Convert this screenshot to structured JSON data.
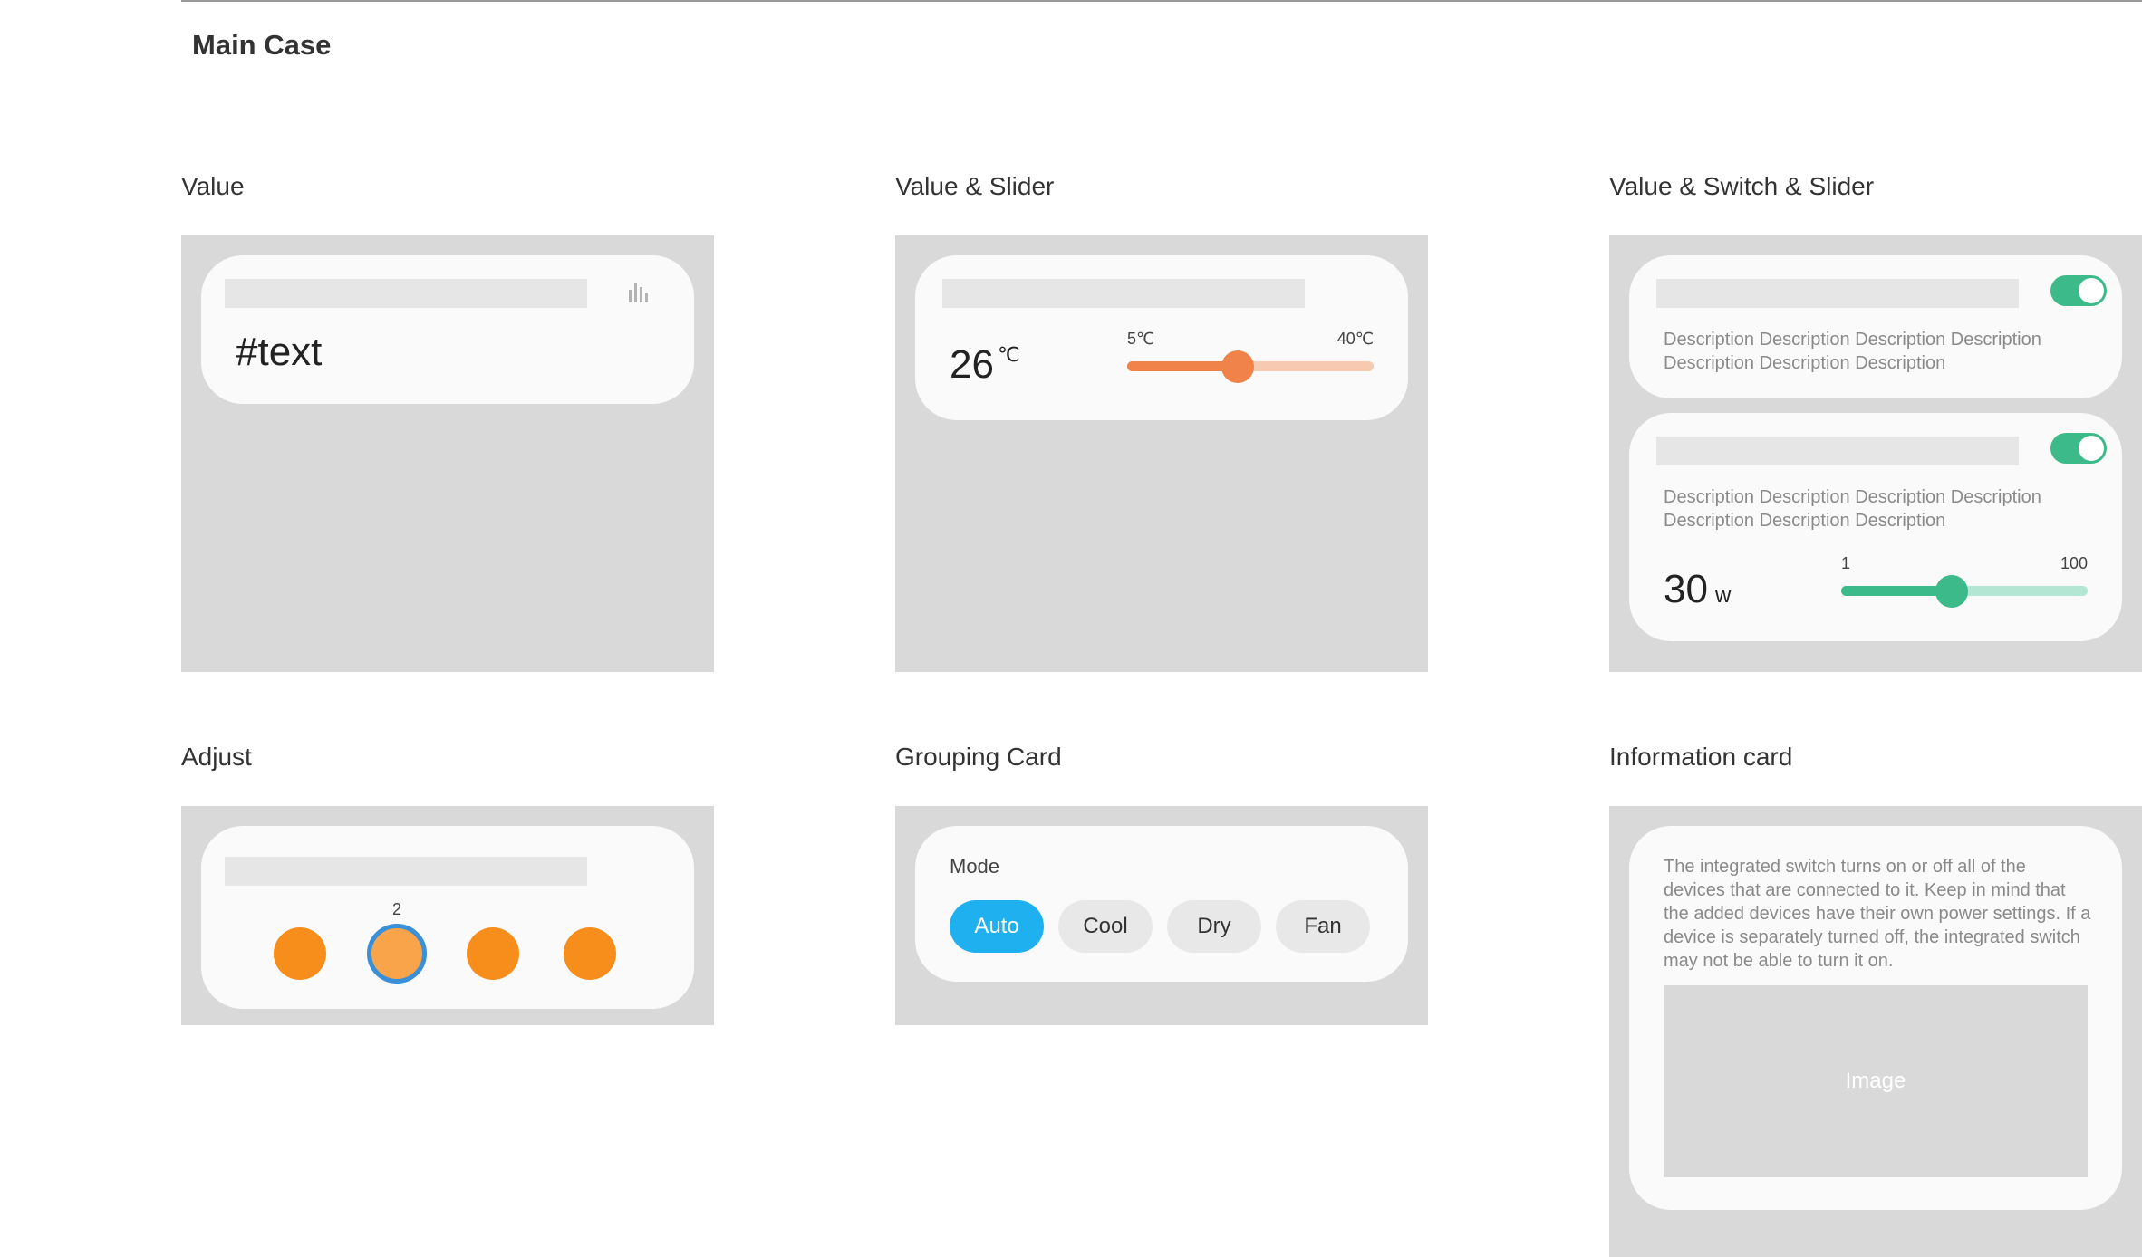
{
  "page": {
    "title": "Main Case"
  },
  "sections": {
    "value": {
      "label": "Value",
      "card": {
        "text": "#text",
        "icon": "bar-chart-icon"
      }
    },
    "value_slider": {
      "label": "Value & Slider",
      "card": {
        "value": "26",
        "unit": "℃",
        "min_label": "5℃",
        "max_label": "40℃",
        "level": 0.45,
        "color": "#f0834a",
        "track_color": "#f6c9b0"
      }
    },
    "value_switch_slider": {
      "label": "Value & Switch & Slider",
      "cards": [
        {
          "toggle_on": true,
          "description": "Description Description Description Description Description Description Description"
        },
        {
          "toggle_on": true,
          "description": "Description Description Description Description Description Description Description",
          "value": "30",
          "unit": "w",
          "min_label": "1",
          "max_label": "100",
          "level": 0.45,
          "color": "#3dba8a",
          "track_color": "#b3e6d3"
        }
      ]
    },
    "adjust": {
      "label": "Adjust",
      "selected_label": "2",
      "selected_index": 1,
      "dot_count": 4,
      "dot_color": "#f78d1b"
    },
    "grouping": {
      "label": "Grouping Card",
      "mode_label": "Mode",
      "options": [
        "Auto",
        "Cool",
        "Dry",
        "Fan"
      ],
      "selected": "Auto",
      "accent": "#1fb0f0"
    },
    "information": {
      "label": "Information card",
      "text": "The integrated switch turns on or off all of the devices that are connected to it. Keep in mind that the added devices have their own power settings. If a device is separately turned off, the integrated switch may not be able to turn it on.",
      "image_label": "Image"
    }
  }
}
